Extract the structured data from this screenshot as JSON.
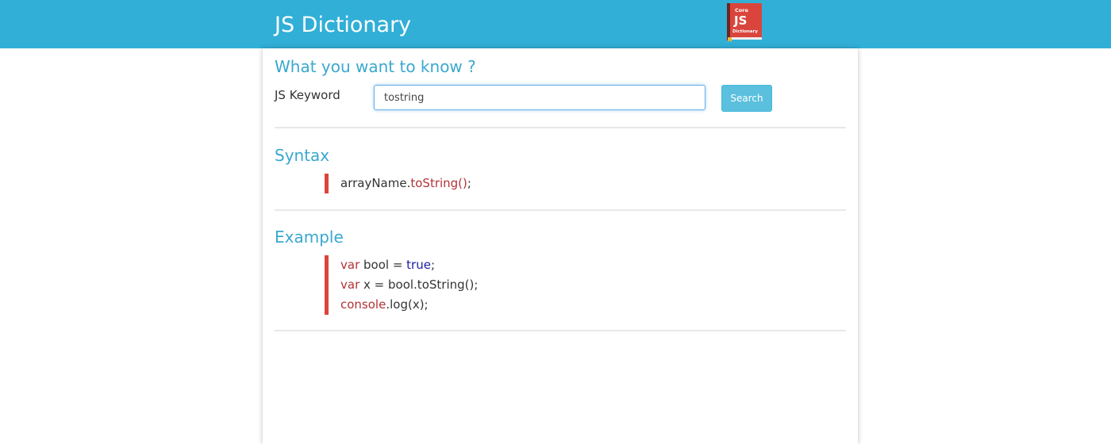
{
  "header": {
    "title": "JS Dictionary",
    "logo": {
      "icon": "book-logo-icon",
      "line1": "Core",
      "line2": "JS",
      "line3": "Dictionary"
    }
  },
  "search": {
    "heading": "What you want to know ?",
    "label": "JS Keyword",
    "value": "tostring",
    "button_label": "Search"
  },
  "syntax": {
    "heading": "Syntax",
    "code": {
      "object": "arrayName.",
      "method": "toString()",
      "end": ";"
    }
  },
  "example": {
    "heading": "Example",
    "lines": [
      {
        "kw": "var",
        "rest": " bool = ",
        "lit": "true",
        "end": ";"
      },
      {
        "kw": "var",
        "rest": " x = bool.toString();"
      },
      {
        "fn": "console",
        "rest": ".log(x);"
      }
    ]
  },
  "colors": {
    "header_bg": "#31afd7",
    "heading": "#3aa8cf",
    "code_bar": "#d9453c",
    "keyword": "#b23237",
    "literal": "#1c1ca6",
    "button": "#5bc0de"
  }
}
